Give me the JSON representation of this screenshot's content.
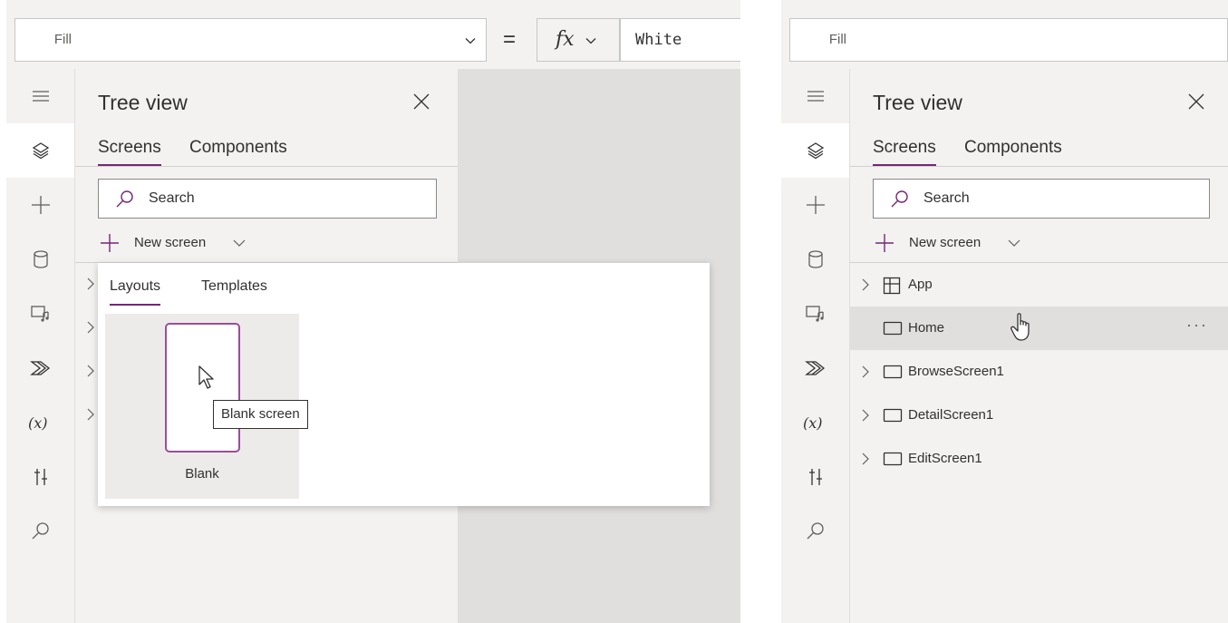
{
  "left": {
    "formula_bar": {
      "property": "Fill",
      "equals": "=",
      "fx": "fx",
      "formula": "White"
    },
    "tree_view": {
      "title": "Tree view",
      "tabs": [
        "Screens",
        "Components"
      ],
      "search_placeholder": "Search",
      "new_screen_label": "New screen"
    },
    "new_screen_flyout": {
      "tabs": [
        "Layouts",
        "Templates"
      ],
      "layout_label": "Blank",
      "tooltip": "Blank screen"
    }
  },
  "right": {
    "formula_bar": {
      "property": "Fill"
    },
    "tree_view": {
      "title": "Tree view",
      "tabs": [
        "Screens",
        "Components"
      ],
      "search_placeholder": "Search",
      "new_screen_label": "New screen",
      "items": [
        {
          "label": "App",
          "icon": "app-grid-icon",
          "expandable": true
        },
        {
          "label": "Home",
          "icon": "screen-icon",
          "expandable": false,
          "hovered": true,
          "more": "···"
        },
        {
          "label": "BrowseScreen1",
          "icon": "screen-icon",
          "expandable": true
        },
        {
          "label": "DetailScreen1",
          "icon": "screen-icon",
          "expandable": true
        },
        {
          "label": "EditScreen1",
          "icon": "screen-icon",
          "expandable": true
        }
      ]
    }
  },
  "rail_icons": [
    "hamburger-menu-icon",
    "layers-icon",
    "plus-insert-icon",
    "data-cylinder-icon",
    "media-icon",
    "power-automate-icon",
    "variables-icon",
    "advanced-tools-icon",
    "search-icon"
  ],
  "colors": {
    "accent": "#742774",
    "panel_bg": "#f3f2f1",
    "canvas_bg": "#e1dfdd",
    "hover_row": "#e1dfdd"
  }
}
